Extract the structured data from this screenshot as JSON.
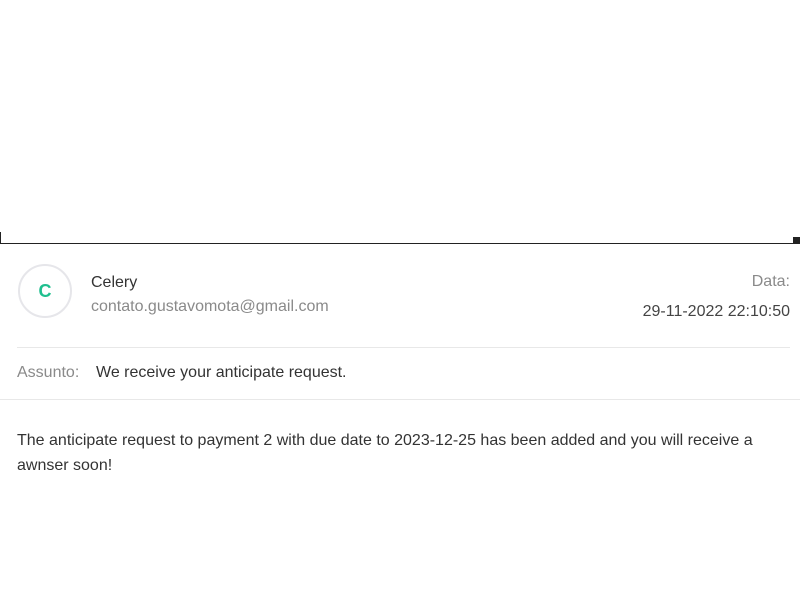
{
  "sender": {
    "avatar_initial": "C",
    "name": "Celery",
    "email": "contato.gustavomota@gmail.com"
  },
  "date": {
    "label": "Data:",
    "value": "29-11-2022 22:10:50"
  },
  "subject": {
    "label": "Assunto:",
    "value": "We receive your anticipate request."
  },
  "message": {
    "body": "The anticipate request to payment 2 with due date to 2023-12-25 has been added and you will receive a awnser soon!"
  },
  "colors": {
    "avatar_accent": "#1fbf8f",
    "muted_text": "#8a8a8a",
    "primary_text": "#333333"
  }
}
